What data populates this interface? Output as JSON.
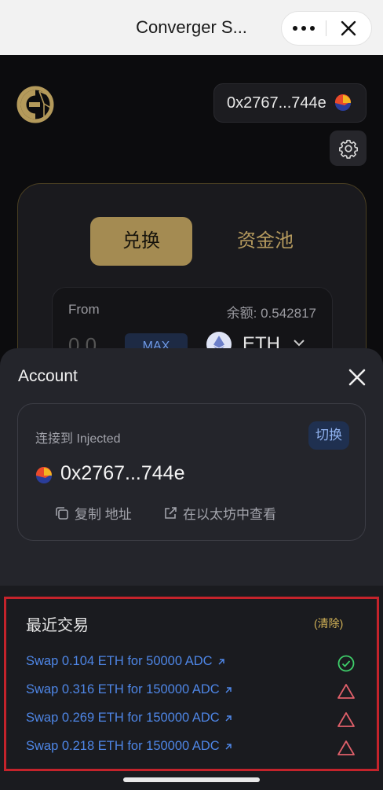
{
  "topbar": {
    "title": "Converger S...",
    "more_icon": "more-dots-icon",
    "close_icon": "close-icon"
  },
  "header": {
    "wallet_address": "0x2767...744e"
  },
  "swap": {
    "tab_swap": "兑换",
    "tab_pool": "资金池",
    "from_label": "From",
    "balance": "余额: 0.542817",
    "amount": "0.0",
    "max_label": "MAX",
    "token_symbol": "ETH"
  },
  "account": {
    "title": "Account",
    "connected_text": "连接到 Injected",
    "switch_label": "切换",
    "address": "0x2767...744e",
    "copy_label": "复制 地址",
    "view_label": "在以太坊中查看"
  },
  "recent": {
    "title": "最近交易",
    "clear_label": "(清除)",
    "transactions": [
      {
        "text": "Swap 0.104 ETH for 50000 ADC",
        "status": "success"
      },
      {
        "text": "Swap 0.316 ETH for 150000 ADC",
        "status": "failed"
      },
      {
        "text": "Swap 0.269 ETH for 150000 ADC",
        "status": "failed"
      },
      {
        "text": "Swap 0.218 ETH for 150000 ADC",
        "status": "failed"
      }
    ]
  },
  "colors": {
    "accent_gold": "#a48b52",
    "link_blue": "#4e86e6",
    "success_green": "#3ecf6a",
    "fail_red": "#e0606a",
    "highlight_red": "#c4232b"
  }
}
